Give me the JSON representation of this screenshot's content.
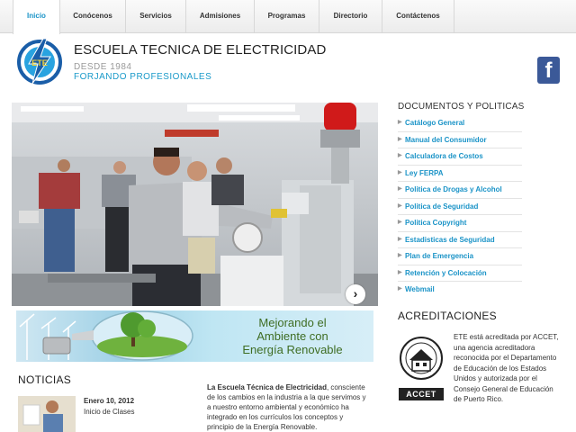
{
  "nav": {
    "items": [
      {
        "label": "Inicio",
        "active": true
      },
      {
        "label": "Conócenos",
        "active": false
      },
      {
        "label": "Servicios",
        "active": false
      },
      {
        "label": "Admisiones",
        "active": false
      },
      {
        "label": "Programas",
        "active": false
      },
      {
        "label": "Directorio",
        "active": false
      },
      {
        "label": "Contáctenos",
        "active": false
      }
    ]
  },
  "header": {
    "logo_text": "ETE",
    "school_name": "ESCUELA TECNICA DE ELECTRICIDAD",
    "since": "DESDE 1984",
    "tagline": "FORJANDO PROFESIONALES",
    "social_icon": "facebook-icon",
    "social_glyph": "f"
  },
  "hero": {
    "next_glyph": "›",
    "next_icon": "chevron-right-icon"
  },
  "banner": {
    "line1": "Mejorando el",
    "line2": "Ambiente con",
    "line3": "Energía Renovable"
  },
  "news": {
    "title": "NOTICIAS",
    "items": [
      {
        "date": "Enero 10, 2012",
        "headline": "Inicio de Clases"
      }
    ],
    "intro_bold": "La Escuela Técnica de Electricidad",
    "intro_rest": ", consciente de los cambios en la industria a la que servimos y a nuestro entorno ambiental y económico ha integrado en los currículos los conceptos y principio de la Energía Renovable."
  },
  "documents": {
    "title": "DOCUMENTOS Y POLITICAS",
    "items": [
      "Catálogo General",
      "Manual del Consumidor",
      "Calculadora de Costos",
      "Ley FERPA",
      "Politica de Drogas y Alcohol",
      "Politica de Seguridad",
      "Politica Copyright",
      "Estadisticas de Seguridad",
      "Plan de Emergencia",
      "Retención y Colocación",
      "Webmail"
    ]
  },
  "accreditation": {
    "title": "ACREDITACIONES",
    "badge": "ACCET",
    "text": "ETE está acreditada por ACCET, una agencia acreditadora reconocida por el Departamento de Educación de los Estados Unidos y autorizada por el Consejo General de Educación de Puerto Rico."
  },
  "colors": {
    "accent": "#1a93c7",
    "nav_bg": "#ececec",
    "banner_text": "#3f6d23",
    "facebook": "#3b5998"
  }
}
